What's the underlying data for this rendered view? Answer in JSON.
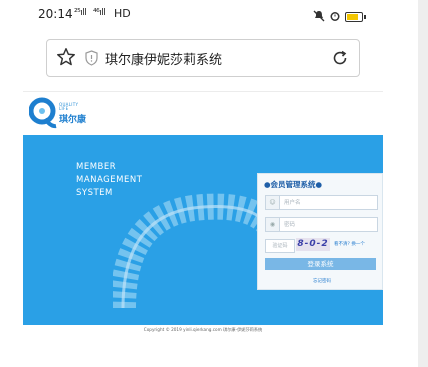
{
  "status_bar": {
    "time": "20:14",
    "signal1": "²⁵ıll",
    "signal2": "⁴⁶ıll",
    "network": "HD",
    "icons": [
      "mute-icon",
      "alarm-icon",
      "battery-icon"
    ]
  },
  "browser": {
    "page_title": "琪尔康伊妮莎莉系统",
    "icons": [
      "star-icon",
      "shield-icon",
      "reload-icon"
    ]
  },
  "logo": {
    "small_text_1": "QUALITY",
    "small_text_2": "LIFE",
    "cn_text": "琪尔康"
  },
  "banner": {
    "line1": "MEMBER",
    "line2": "MANAGEMENT",
    "line3": "SYSTEM"
  },
  "login": {
    "title": "●会员管理系统●",
    "username_placeholder": "用户名",
    "password_placeholder": "密码",
    "captcha_placeholder": "验证码",
    "captcha_code": "8-0-2",
    "captcha_link": "看不清? 换一个",
    "login_button": "登录系统",
    "forgot": "忘记密码"
  },
  "footer": {
    "copyright": "Copyright © 2019 yinli.qierkang.com 琪尔康-伊妮莎莉系统"
  },
  "colors": {
    "banner": "#2aa0e6",
    "button": "#79b7e6",
    "title_text": "#1f5fa8"
  }
}
